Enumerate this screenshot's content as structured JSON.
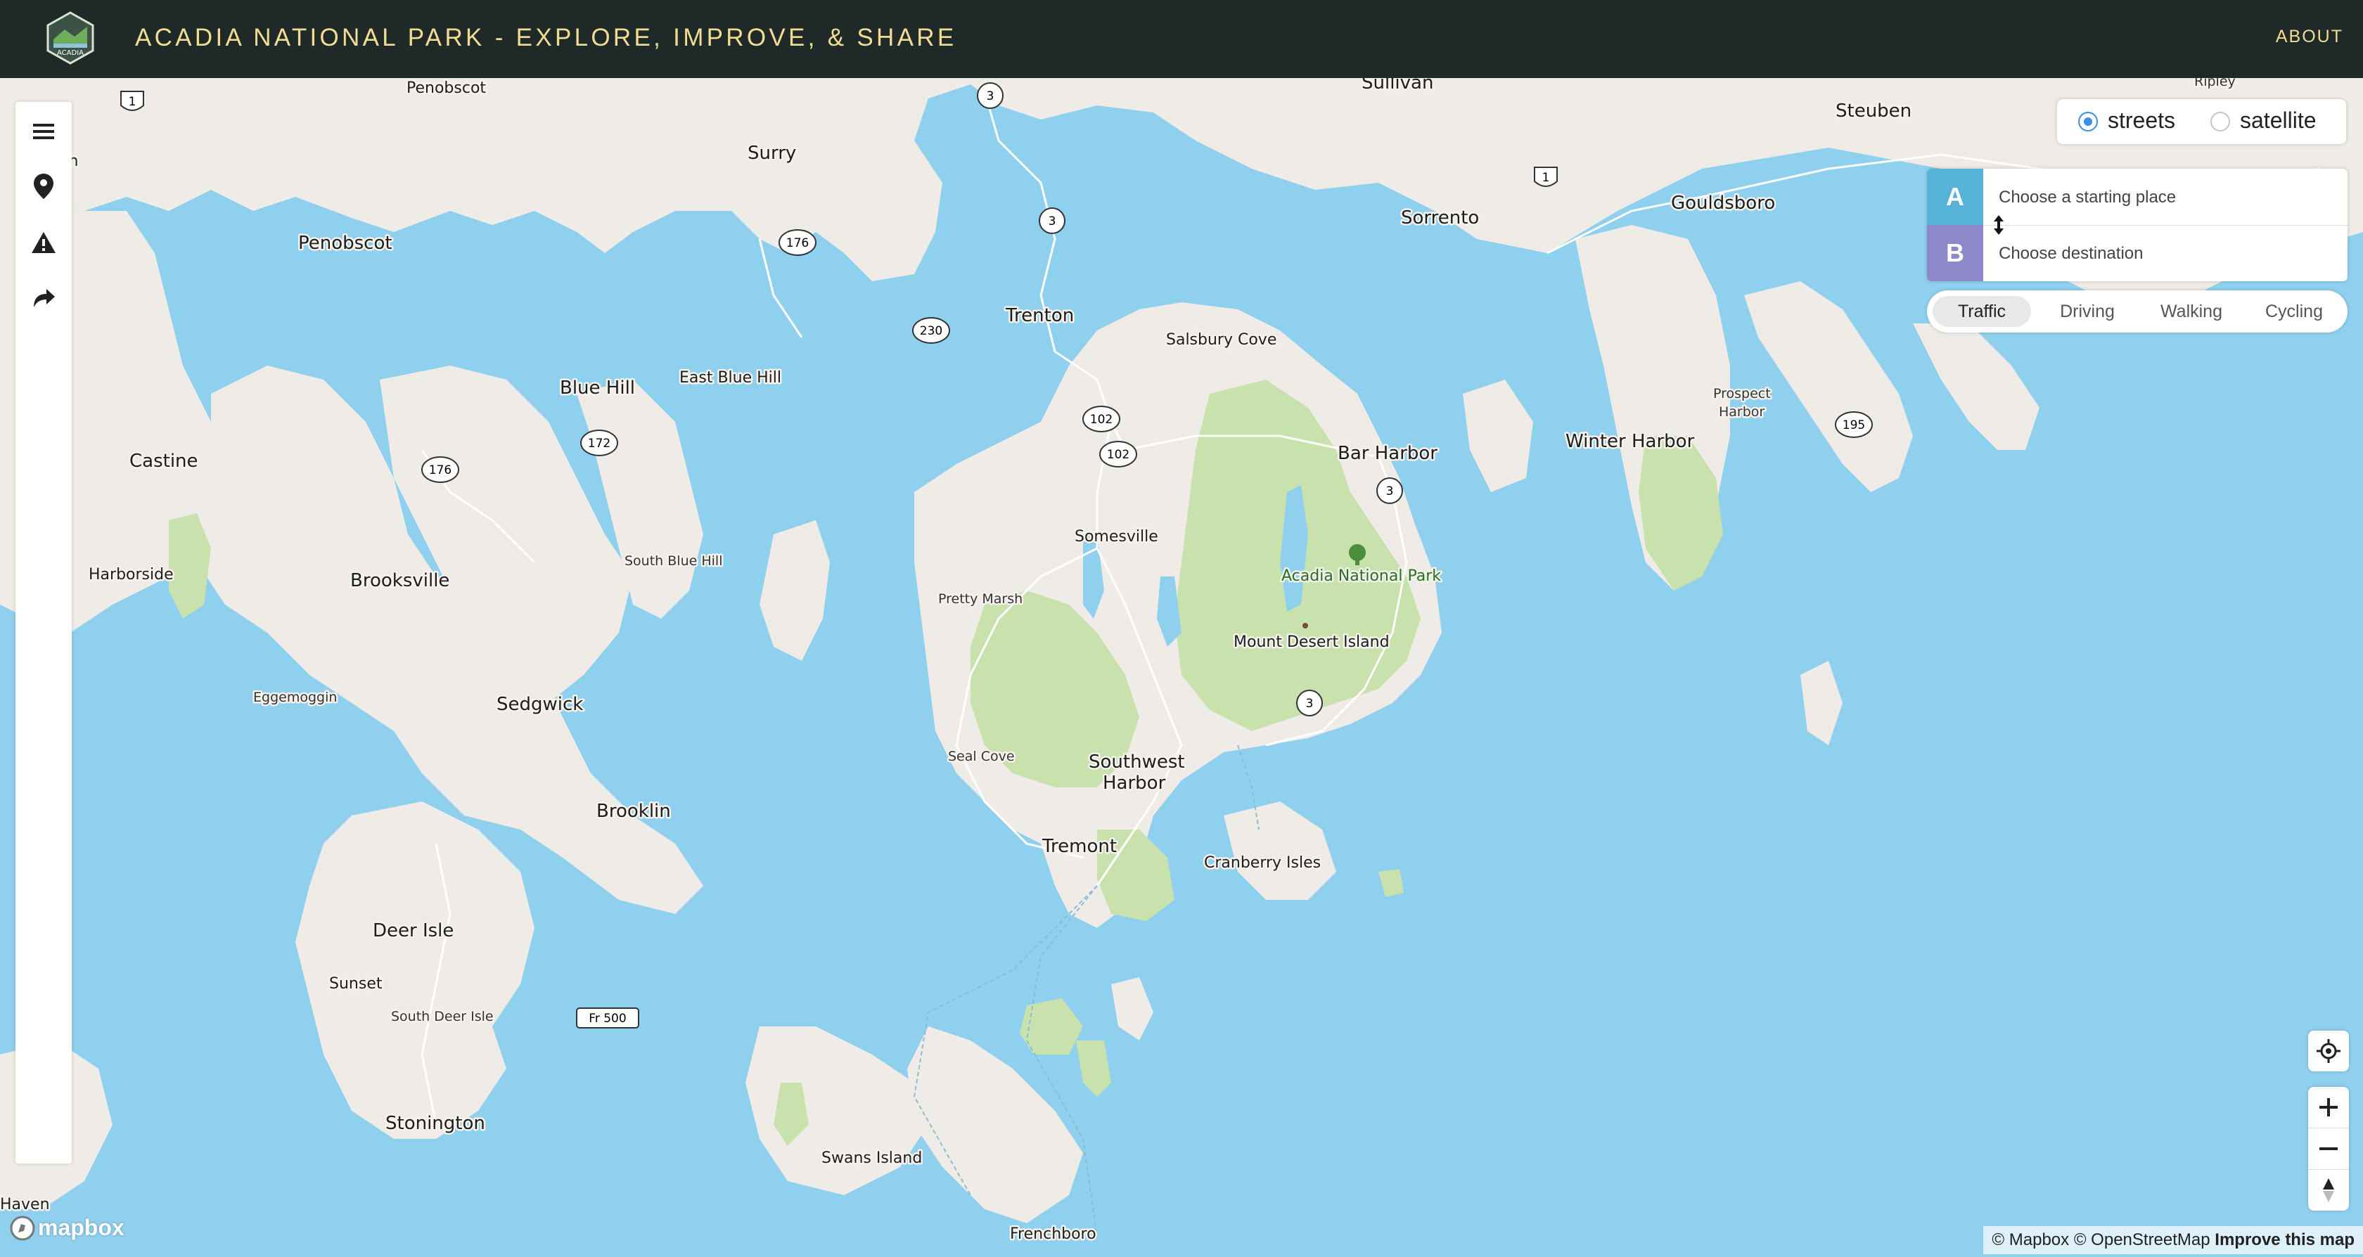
{
  "header": {
    "title": "ACADIA NATIONAL PARK - EXPLORE, IMPROVE, & SHARE",
    "about_label": "ABOUT",
    "logo_text": "ACADIA"
  },
  "sidebar": {
    "items": [
      {
        "name": "menu-icon"
      },
      {
        "name": "map-pin-icon"
      },
      {
        "name": "warning-icon"
      },
      {
        "name": "directions-arrow-icon"
      }
    ]
  },
  "map_style": {
    "options": [
      {
        "label": "streets",
        "selected": true
      },
      {
        "label": "satellite",
        "selected": false
      }
    ]
  },
  "directions": {
    "origin_label": "A",
    "origin_placeholder": "Choose a starting place",
    "destination_label": "B",
    "destination_placeholder": "Choose destination",
    "profiles": [
      "Traffic",
      "Driving",
      "Walking",
      "Cycling"
    ],
    "active_profile": "Traffic"
  },
  "map": {
    "places": [
      "Penobscot",
      "Surry",
      "Sullivan",
      "Steuben",
      "Ripley",
      "Penobscot",
      "Gouldsboro",
      "Sorrento",
      "Trenton",
      "Salsbury Cove",
      "Blue Hill",
      "East Blue Hill",
      "Castine",
      "Bar Harbor",
      "Winter Harbor",
      "Prospect",
      "Harbor",
      "Somesville",
      "Harborside",
      "Brooksville",
      "South Blue Hill",
      "Pretty Marsh",
      "Acadia National Park",
      "Mount Desert Island",
      "Eggemoggin",
      "Sedgwick",
      "Seal Cove",
      "Southwest",
      "Harbor",
      "Brooklin",
      "Tremont",
      "Cranberry Isles",
      "Deer Isle",
      "Sunset",
      "South Deer Isle",
      "Stonington",
      "Swans Island",
      "Frenchboro",
      "Haven"
    ],
    "route_shields": [
      "1",
      "3",
      "3",
      "176",
      "230",
      "102",
      "102",
      "172",
      "176",
      "3",
      "3",
      "1",
      "195",
      "Fr 500"
    ],
    "edge_labels": [
      "S",
      "on",
      "S",
      "s"
    ]
  },
  "attribution": {
    "mapbox": "© Mapbox",
    "osm": "© OpenStreetMap",
    "improve": "Improve this map",
    "logo": "mapbox"
  }
}
